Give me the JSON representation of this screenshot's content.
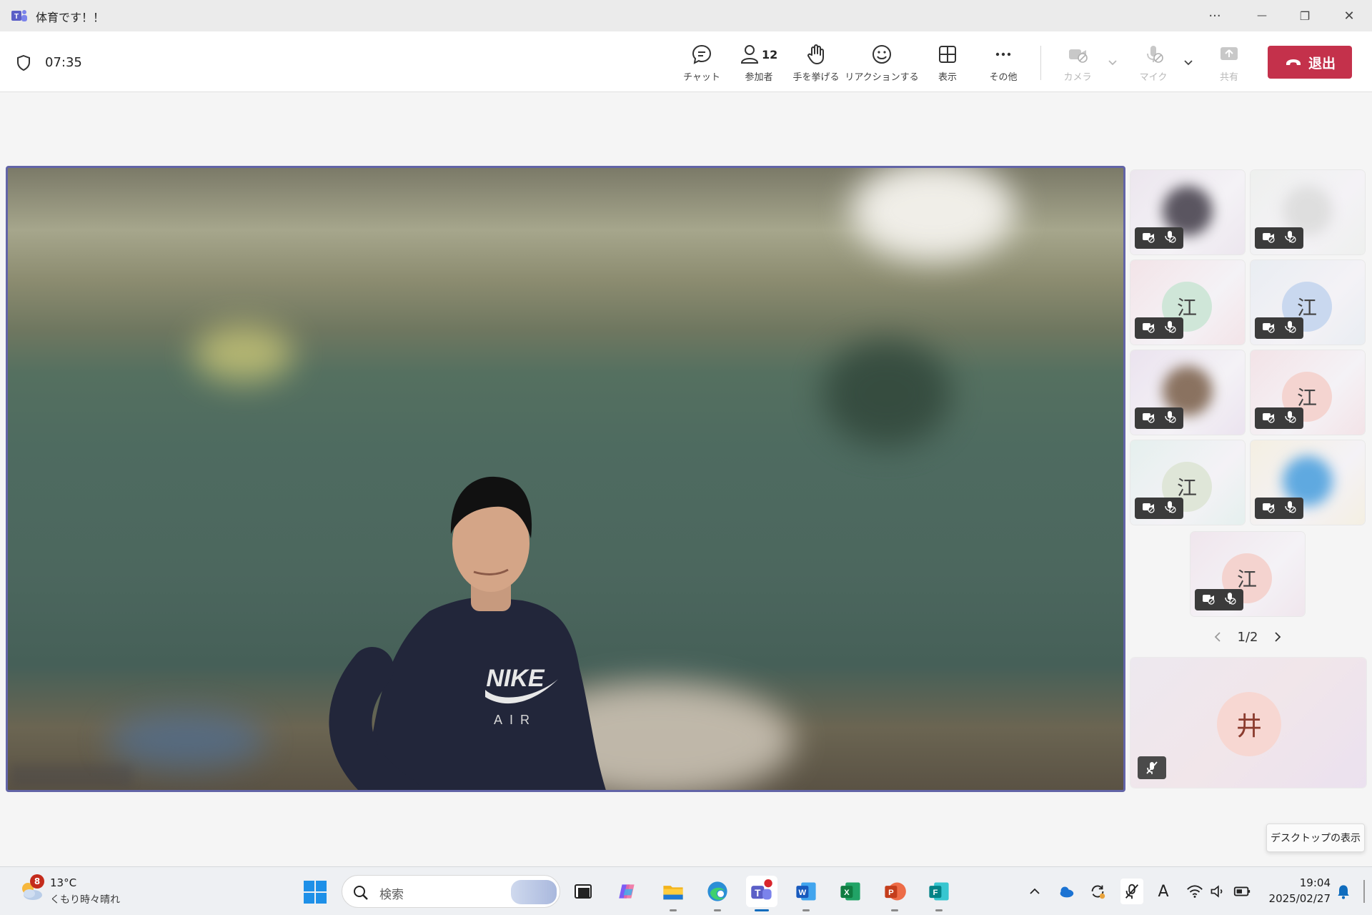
{
  "window": {
    "title": "体育です！！",
    "more_glyph": "···",
    "minimize_glyph": "—",
    "maximize_glyph": "❐",
    "close_glyph": "✕"
  },
  "meeting": {
    "elapsed_time": "07:35",
    "participant_count": "12",
    "toolbar": {
      "chat_label": "チャット",
      "participants_label": "参加者",
      "raise_hand_label": "手を挙げる",
      "react_label": "リアクションする",
      "view_label": "表示",
      "more_label": "その他",
      "camera_label": "カメラ",
      "mic_label": "マイク",
      "share_label": "共有",
      "leave_label": "退出"
    },
    "participants": [
      {
        "initial": "",
        "type": "photo",
        "avatar_color": "#5a5560",
        "bg": "#ece6ee"
      },
      {
        "initial": "",
        "type": "photo",
        "avatar_color": "#dedede",
        "bg": "#eef0ee"
      },
      {
        "initial": "江",
        "type": "initial",
        "avatar_color": "#cfe6d8",
        "bg": "#f3e4e8"
      },
      {
        "initial": "江",
        "type": "initial",
        "avatar_color": "#c9d8ef",
        "bg": "#e9edf2"
      },
      {
        "initial": "",
        "type": "photo",
        "avatar_color": "#8a7260",
        "bg": "#ebe3ef"
      },
      {
        "initial": "江",
        "type": "initial",
        "avatar_color": "#f4d4d0",
        "bg": "#f3e3e7"
      },
      {
        "initial": "江",
        "type": "initial",
        "avatar_color": "#dfe6d8",
        "bg": "#e5f0ee"
      },
      {
        "initial": "",
        "type": "photo",
        "avatar_color": "#5fa9e0",
        "bg": "#f4efe2"
      },
      {
        "initial": "江",
        "type": "initial",
        "avatar_color": "#f4d3cf",
        "bg": "#f0e6ed"
      }
    ],
    "pager": "1/2",
    "self": {
      "initial": "井"
    },
    "tooltip": "デスクトップの表示"
  },
  "taskbar": {
    "weather_temp": "13°C",
    "weather_condition": "くもり時々晴れ",
    "weather_badge": "8",
    "search_placeholder": "検索",
    "apps": [
      "task-view",
      "copilot",
      "file-explorer",
      "edge",
      "teams",
      "word",
      "excel",
      "powerpoint",
      "forms"
    ],
    "time": "19:04",
    "date": "2025/02/27",
    "ime_label": "A"
  },
  "colors": {
    "accent": "#6264a7",
    "leave": "#c4314b",
    "taskbar_active": "#0f6cbd"
  }
}
